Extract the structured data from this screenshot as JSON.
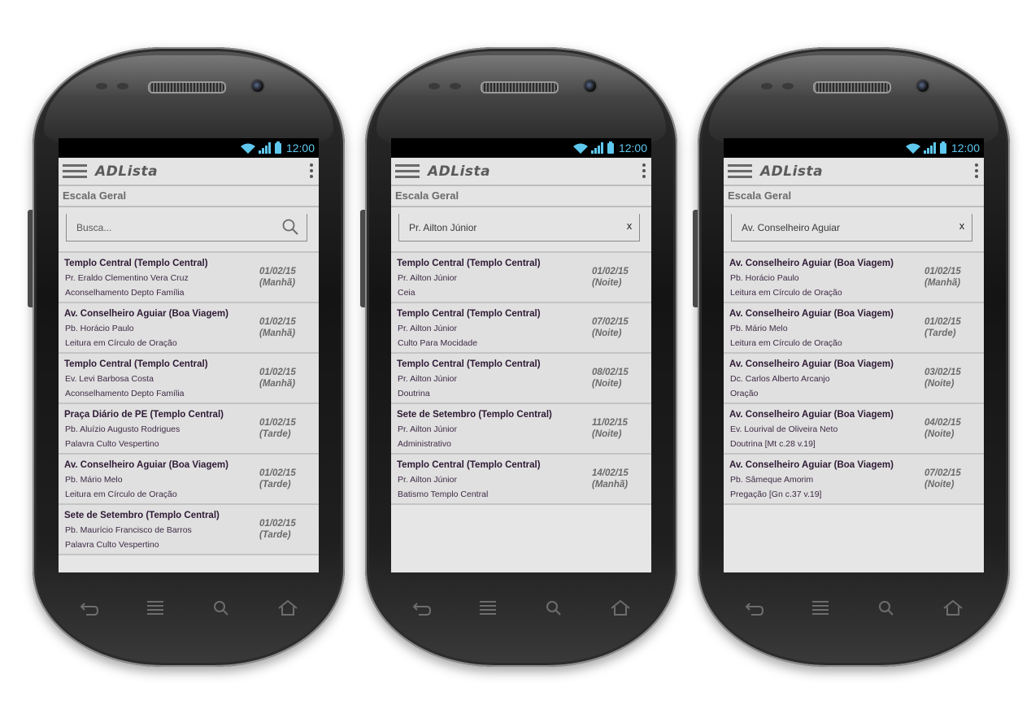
{
  "colors": {
    "status_accent": "#5fc8ee",
    "title_text": "#2e1a35",
    "date_text": "#6a6a6a"
  },
  "icons": [
    "wifi-icon",
    "signal-icon",
    "battery-icon",
    "menu-icon",
    "overflow-icon",
    "search-icon",
    "clear-icon",
    "back-icon",
    "home-icon",
    "recent-apps-icon"
  ],
  "phones": [
    {
      "status_time": "12:00",
      "app_title": "ADLista",
      "section": "Escala Geral",
      "search": {
        "text": "Busca...",
        "is_placeholder": true
      },
      "items": [
        {
          "title": "Templo Central (Templo Central)",
          "person": "Pr. Eraldo Clementino Vera Cruz",
          "activity": "Aconselhamento Depto Família",
          "date": "01/02/15",
          "period": "(Manhã)"
        },
        {
          "title": "Av. Conselheiro Aguiar (Boa Viagem)",
          "person": "Pb. Horácio Paulo",
          "activity": "Leitura em Círculo de Oração",
          "date": "01/02/15",
          "period": "(Manhã)"
        },
        {
          "title": "Templo Central (Templo Central)",
          "person": "Ev. Levi Barbosa Costa",
          "activity": "Aconselhamento Depto Família",
          "date": "01/02/15",
          "period": "(Manhã)"
        },
        {
          "title": "Praça Diário de  PE (Templo Central)",
          "person": "Pb. Aluízio Augusto Rodrigues",
          "activity": "Palavra Culto Vespertino",
          "date": "01/02/15",
          "period": "(Tarde)"
        },
        {
          "title": "Av. Conselheiro Aguiar (Boa Viagem)",
          "person": "Pb. Mário Melo",
          "activity": "Leitura em Círculo de Oração",
          "date": "01/02/15",
          "period": "(Tarde)"
        },
        {
          "title": "Sete de Setembro (Templo Central)",
          "person": "Pb. Maurício Francisco de Barros",
          "activity": "Palavra Culto Vespertino",
          "date": "01/02/15",
          "period": "(Tarde)"
        }
      ]
    },
    {
      "status_time": "12:00",
      "app_title": "ADLista",
      "section": "Escala Geral",
      "search": {
        "text": "Pr. Ailton Júnior",
        "is_placeholder": false,
        "clear_label": "x"
      },
      "items": [
        {
          "title": "Templo Central (Templo Central)",
          "person": "Pr. Ailton Júnior",
          "activity": "Ceia",
          "date": "01/02/15",
          "period": "(Noite)"
        },
        {
          "title": "Templo Central (Templo Central)",
          "person": "Pr. Ailton Júnior",
          "activity": "Culto Para Mocidade",
          "date": "07/02/15",
          "period": "(Noite)"
        },
        {
          "title": "Templo Central (Templo Central)",
          "person": "Pr. Ailton Júnior",
          "activity": "Doutrina",
          "date": "08/02/15",
          "period": "(Noite)"
        },
        {
          "title": "Sete de Setembro (Templo Central)",
          "person": "Pr. Ailton Júnior",
          "activity": "Administrativo",
          "date": "11/02/15",
          "period": "(Noite)"
        },
        {
          "title": "Templo Central (Templo Central)",
          "person": "Pr. Ailton Júnior",
          "activity": "Batismo Templo Central",
          "date": "14/02/15",
          "period": "(Manhã)"
        }
      ]
    },
    {
      "status_time": "12:00",
      "app_title": "ADLista",
      "section": "Escala Geral",
      "search": {
        "text": "Av. Conselheiro Aguiar",
        "is_placeholder": false,
        "clear_label": "x"
      },
      "items": [
        {
          "title": "Av. Conselheiro Aguiar (Boa Viagem)",
          "person": "Pb. Horácio Paulo",
          "activity": "Leitura em Círculo de Oração",
          "date": "01/02/15",
          "period": "(Manhã)"
        },
        {
          "title": "Av. Conselheiro Aguiar (Boa Viagem)",
          "person": "Pb. Mário Melo",
          "activity": "Leitura em Círculo de Oração",
          "date": "01/02/15",
          "period": "(Tarde)"
        },
        {
          "title": "Av. Conselheiro Aguiar (Boa Viagem)",
          "person": "Dc. Carlos Alberto Arcanjo",
          "activity": "Oração",
          "date": "03/02/15",
          "period": "(Noite)"
        },
        {
          "title": "Av. Conselheiro Aguiar (Boa Viagem)",
          "person": "Ev. Lourival de Oliveira Neto",
          "activity": "Doutrina [Mt c.28 v.19]",
          "date": "04/02/15",
          "period": "(Noite)"
        },
        {
          "title": "Av. Conselheiro Aguiar (Boa Viagem)",
          "person": "Pb. Sâmeque Amorim",
          "activity": "Pregação [Gn c.37 v.19]",
          "date": "07/02/15",
          "period": "(Noite)"
        }
      ]
    }
  ]
}
